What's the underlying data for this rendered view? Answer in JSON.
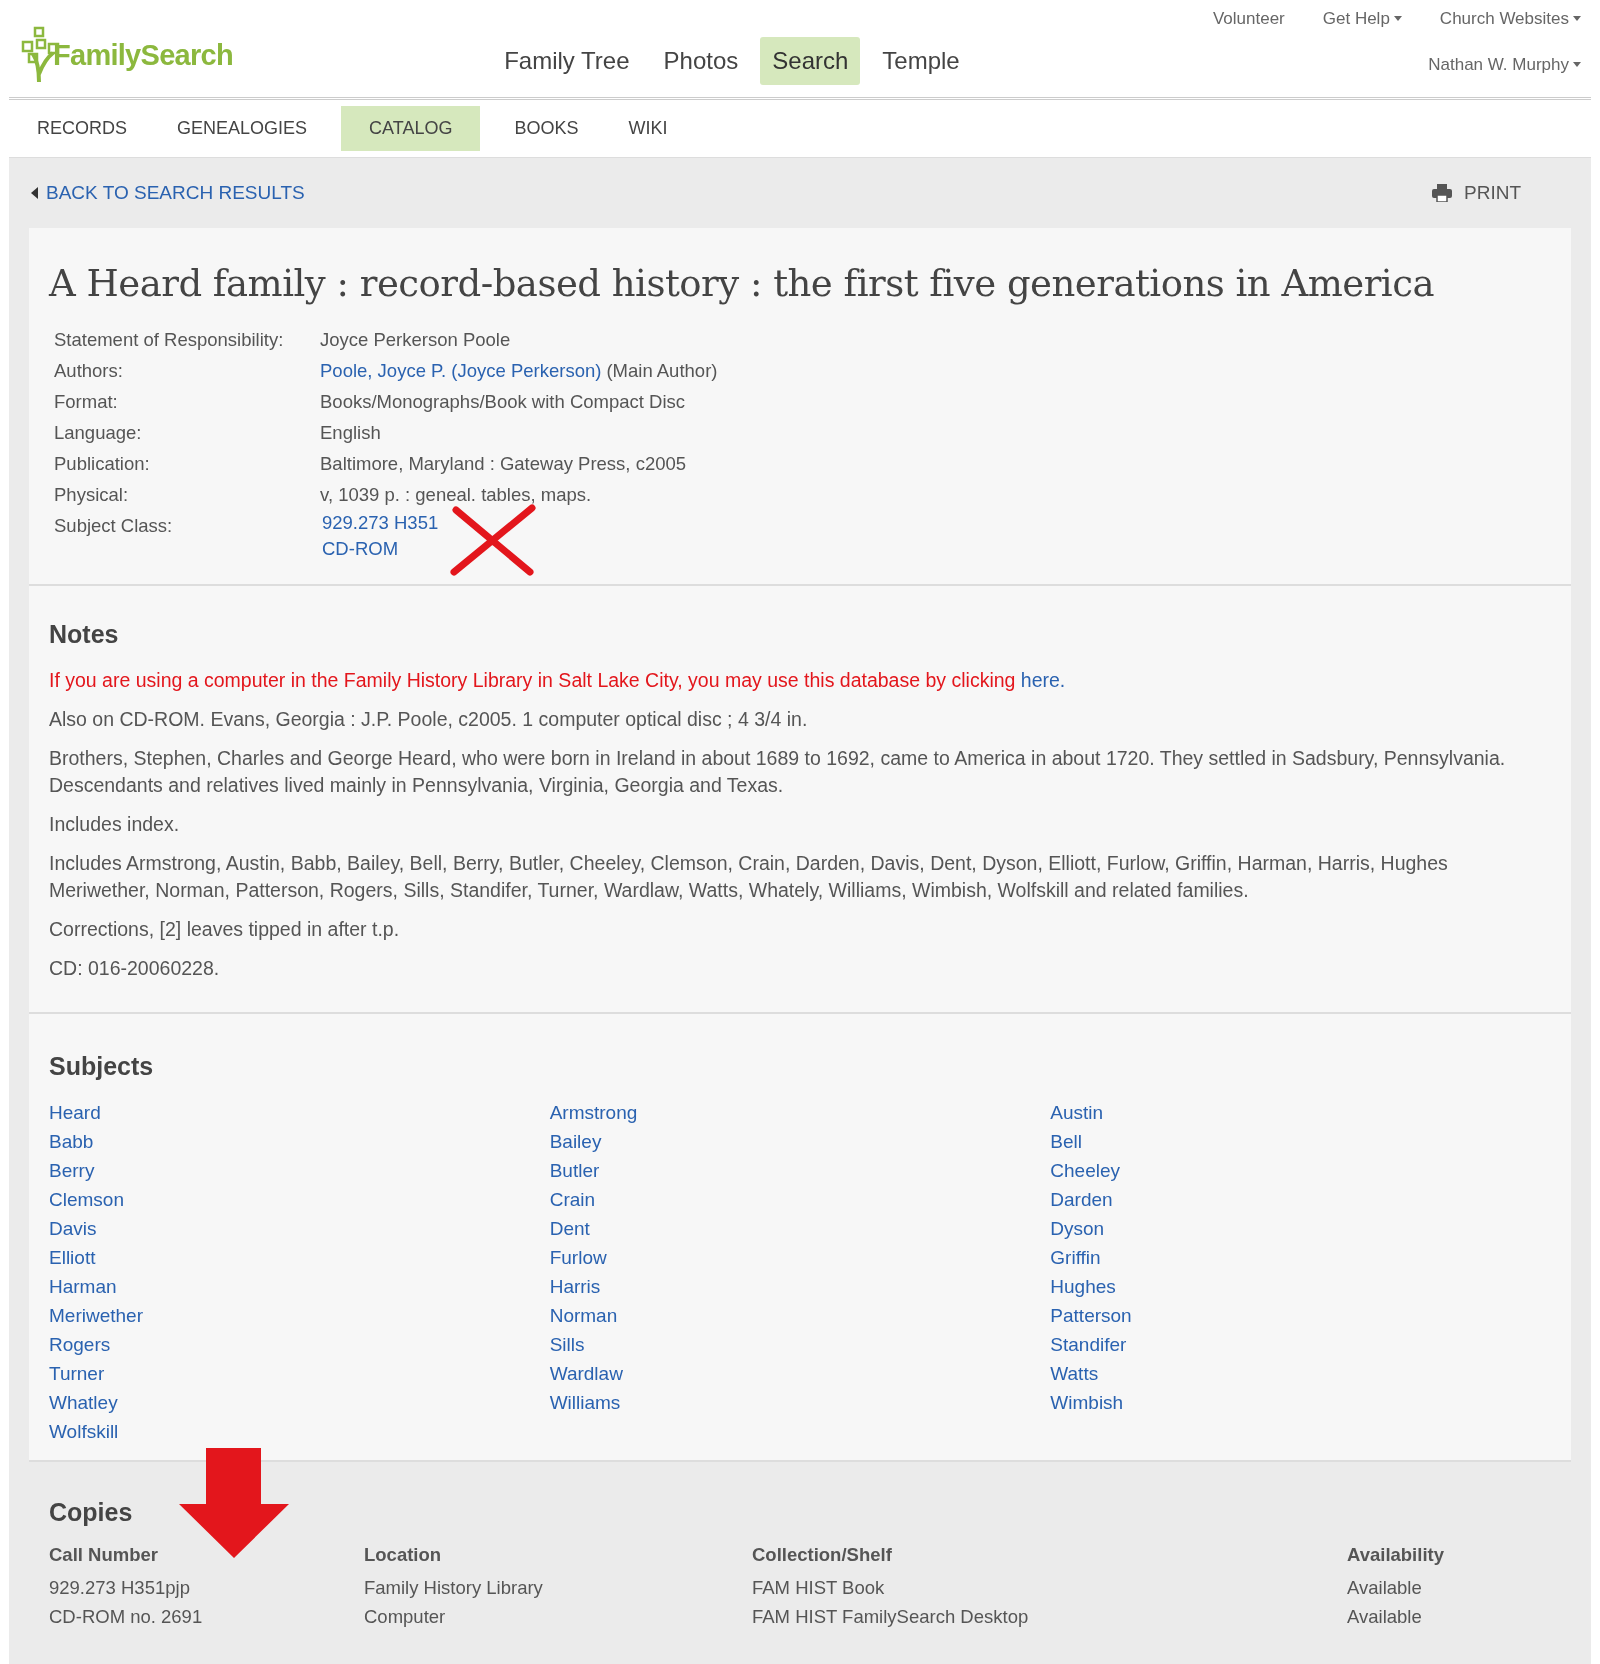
{
  "header": {
    "logo": "FamilySearch",
    "top_links": [
      {
        "label": "Volunteer",
        "dropdown": false
      },
      {
        "label": "Get Help",
        "dropdown": true
      },
      {
        "label": "Church Websites",
        "dropdown": true
      }
    ],
    "main_nav": [
      {
        "label": "Family Tree",
        "selected": false
      },
      {
        "label": "Photos",
        "selected": false
      },
      {
        "label": "Search",
        "selected": true
      },
      {
        "label": "Temple",
        "selected": false
      }
    ],
    "user": {
      "label": "Nathan W. Murphy",
      "dropdown": true
    }
  },
  "tabs": [
    {
      "label": "RECORDS",
      "selected": false
    },
    {
      "label": "GENEALOGIES",
      "selected": false
    },
    {
      "label": "CATALOG",
      "selected": true
    },
    {
      "label": "BOOKS",
      "selected": false
    },
    {
      "label": "WIKI",
      "selected": false
    }
  ],
  "back_link": "BACK TO SEARCH RESULTS",
  "print_button": "PRINT",
  "record": {
    "title": "A Heard family : record-based history : the first five generations in America",
    "fields": [
      {
        "label": "Statement of Responsibility:",
        "lines": [
          [
            {
              "kind": "text",
              "text": "Joyce Perkerson Poole"
            }
          ]
        ]
      },
      {
        "label": "Authors:",
        "lines": [
          [
            {
              "kind": "link",
              "text": "Poole, Joyce P. (Joyce Perkerson)"
            },
            {
              "kind": "text",
              "text": "(Main Author)"
            }
          ]
        ]
      },
      {
        "label": "Format:",
        "lines": [
          [
            {
              "kind": "text",
              "text": "Books/Monographs/Book with Compact Disc"
            }
          ]
        ]
      },
      {
        "label": "Language:",
        "lines": [
          [
            {
              "kind": "text",
              "text": "English"
            }
          ]
        ]
      },
      {
        "label": "Publication:",
        "lines": [
          [
            {
              "kind": "text",
              "text": "Baltimore, Maryland : Gateway Press, c2005"
            }
          ]
        ]
      },
      {
        "label": "Physical:",
        "lines": [
          [
            {
              "kind": "text",
              "text": "v, 1039 p. : geneal. tables, maps."
            }
          ]
        ]
      },
      {
        "label": "Subject Class:",
        "lines": [
          [
            {
              "kind": "link",
              "text": "929.273 H351"
            }
          ],
          [
            {
              "kind": "link",
              "text": "CD-ROM"
            }
          ]
        ],
        "crossed_out": true
      }
    ]
  },
  "notes": {
    "heading": "Notes",
    "items": [
      {
        "kind": "alert",
        "text": "If you are using a computer in the Family History Library in Salt Lake City, you may use this database by clicking",
        "link": "here."
      },
      {
        "kind": "plain",
        "text": "Also on CD-ROM. Evans, Georgia : J.P. Poole, c2005. 1 computer optical disc ; 4 3/4 in."
      },
      {
        "kind": "plain",
        "text": "Brothers, Stephen, Charles and George Heard, who were born in Ireland in about 1689 to 1692, came to America in about 1720. They settled in Sadsbury, Pennsylvania. Descendants and relatives lived mainly in Pennsylvania, Virginia, Georgia and Texas."
      },
      {
        "kind": "plain",
        "text": "Includes index."
      },
      {
        "kind": "plain",
        "text": "Includes Armstrong, Austin, Babb, Bailey, Bell, Berry, Butler, Cheeley, Clemson, Crain, Darden, Davis, Dent, Dyson, Elliott, Furlow, Griffin, Harman, Harris, Hughes Meriwether, Norman, Patterson, Rogers, Sills, Standifer, Turner, Wardlaw, Watts, Whately, Williams, Wimbish, Wolfskill and related families."
      },
      {
        "kind": "plain",
        "text": "Corrections, [2] leaves tipped in after t.p."
      },
      {
        "kind": "plain",
        "text": "CD: 016-20060228."
      }
    ]
  },
  "subjects": {
    "heading": "Subjects",
    "columns": [
      [
        "Heard",
        "Babb",
        "Berry",
        "Clemson",
        "Davis",
        "Elliott",
        "Harman",
        "Meriwether",
        "Rogers",
        "Turner",
        "Whatley",
        "Wolfskill"
      ],
      [
        "Armstrong",
        "Bailey",
        "Butler",
        "Crain",
        "Dent",
        "Furlow",
        "Harris",
        "Norman",
        "Sills",
        "Wardlaw",
        "Williams"
      ],
      [
        "Austin",
        "Bell",
        "Cheeley",
        "Darden",
        "Dyson",
        "Griffin",
        "Hughes",
        "Patterson",
        "Standifer",
        "Watts",
        "Wimbish"
      ]
    ]
  },
  "copies": {
    "heading": "Copies",
    "pointer_arrow": true,
    "columns": [
      "Call Number",
      "Location",
      "Collection/Shelf",
      "Availability"
    ],
    "rows": [
      [
        "929.273 H351pjp",
        "Family History Library",
        "FAM HIST Book",
        "Available"
      ],
      [
        "CD-ROM no. 2691",
        "Computer",
        "FAM HIST FamilySearch Desktop",
        "Available"
      ]
    ]
  }
}
